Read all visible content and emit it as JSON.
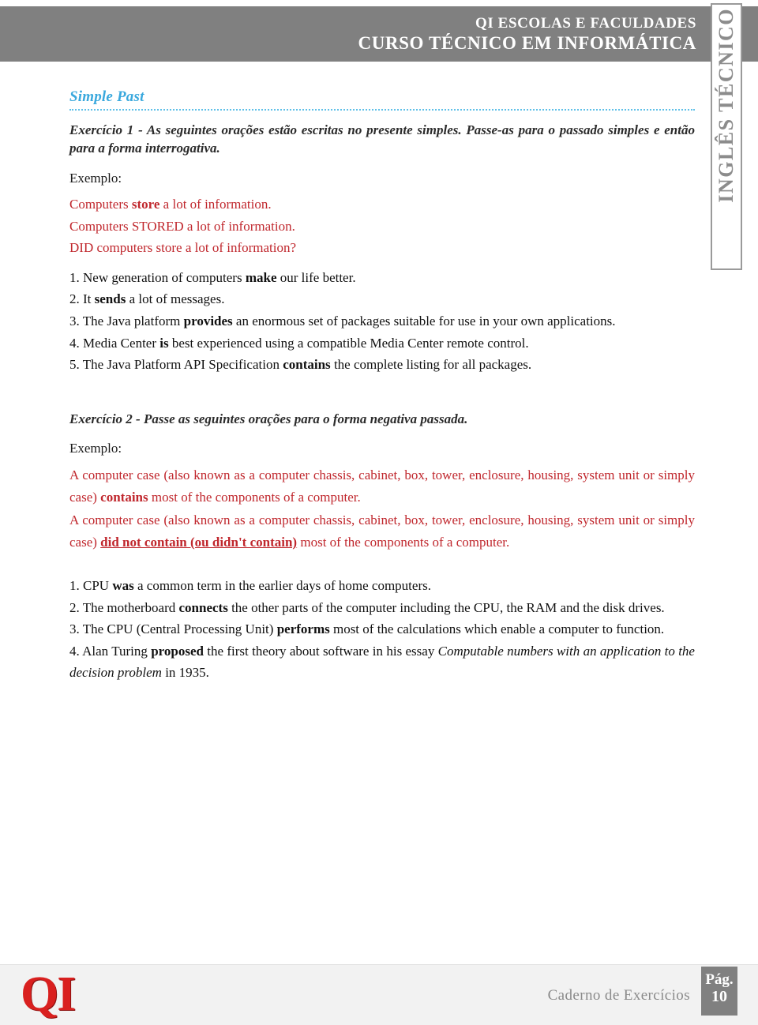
{
  "header": {
    "line1": "QI ESCOLAS E FACULDADES",
    "line2": "CURSO TÉCNICO EM INFORMÁTICA"
  },
  "side_tab": {
    "label": "INGLÊS TÉCNICO"
  },
  "content": {
    "section_heading": "Simple Past",
    "exercise1": {
      "instruction": "Exercício 1 - As seguintes orações estão escritas no presente simples. Passe-as para o passado simples e então para a forma interrogativa.",
      "example_label": "Exemplo:",
      "example_lines": [
        "Computers store a lot of information.",
        "Computers STORED a lot of information.",
        "DID computers store a lot of information?"
      ],
      "items": [
        "1. New generation of computers make our life better.",
        "2. It sends a lot of messages.",
        "3. The Java platform provides an enormous set of packages suitable for use in your own applications.",
        "4. Media Center is best experienced using a compatible Media Center remote control.",
        "5. The Java Platform API Specification contains the complete listing for all packages."
      ]
    },
    "exercise2": {
      "instruction": "Exercício 2 - Passe as seguintes orações para o forma negativa passada.",
      "example_label": "Exemplo:",
      "example_before": "A computer case (also known as a computer chassis, cabinet, box, tower, enclosure, housing, system unit or simply case) contains most of the components of a computer.",
      "example_after": "A computer case (also known as a computer chassis, cabinet, box, tower, enclosure, housing, system unit or simply case) did not contain (ou didn't contain) most of the components of a computer.",
      "items": [
        "1. CPU was a common term in the earlier days of home computers.",
        "2. The motherboard connects the other parts of the computer including the CPU, the RAM and the disk drives.",
        "3. The CPU (Central Processing Unit) performs most of the calculations which enable a computer to function.",
        "4. Alan Turing proposed the first theory about software in his essay Computable numbers with an application to the decision problem in 1935."
      ]
    }
  },
  "fragments": {
    "ex1_ex_l1_a": "Computers ",
    "ex1_ex_l1_b": "store",
    "ex1_ex_l1_c": " a lot of information.",
    "ex1_ex_l2": "Computers STORED a lot of information.",
    "ex1_ex_l3": "DID computers store a lot of information?",
    "i1_a": "1. New generation of computers ",
    "i1_b": "make",
    "i1_c": " our life better.",
    "i2_a": "2. It ",
    "i2_b": "sends",
    "i2_c": " a lot of messages.",
    "i3_a": "3. The Java platform ",
    "i3_b": "provides",
    "i3_c": " an enormous set of packages suitable for use in your own applications.",
    "i4_a": "4. Media Center ",
    "i4_b": "is",
    "i4_c": " best experienced using a compatible Media Center remote control.",
    "i5_a": "5. The Java Platform API Specification ",
    "i5_b": "contains",
    "i5_c": " the complete listing for all packages.",
    "ex2_before_a": "A computer case (also known as a computer chassis, cabinet, box, tower, enclosure, housing, system unit or simply case) ",
    "ex2_before_b": "contains",
    "ex2_before_c": " most of the components of a computer.",
    "ex2_after_a": "A computer case (also known as a computer chassis, cabinet, box, tower, enclosure, housing, system unit or simply case) ",
    "ex2_after_b": "did not contain (ou didn't contain)",
    "ex2_after_c": " most of the components of a computer.",
    "j1_a": "1. CPU ",
    "j1_b": "was",
    "j1_c": " a common term in the earlier days of home computers.",
    "j2_a": "2. The motherboard ",
    "j2_b": "connects",
    "j2_c": " the other parts of the computer including the CPU, the RAM and the disk drives.",
    "j3_a": "3. The CPU (Central Processing Unit) ",
    "j3_b": "performs",
    "j3_c": " most of the calculations which enable a computer to function.",
    "j4_a": "4. Alan Turing ",
    "j4_b": "proposed",
    "j4_c": " the first theory about software in his essay ",
    "j4_d": "Computable numbers with an application to the decision problem",
    "j4_e": " in 1935."
  },
  "footer": {
    "logo_text": "QI",
    "caption": "Caderno de Exercícios",
    "page_label": "Pág.",
    "page_number": "10"
  },
  "colors": {
    "header_gray": "#808080",
    "heading_blue": "#39a8dd",
    "example_red": "#c0272d",
    "logo_red": "#d9201f",
    "footer_bg": "#f2f2f2"
  }
}
